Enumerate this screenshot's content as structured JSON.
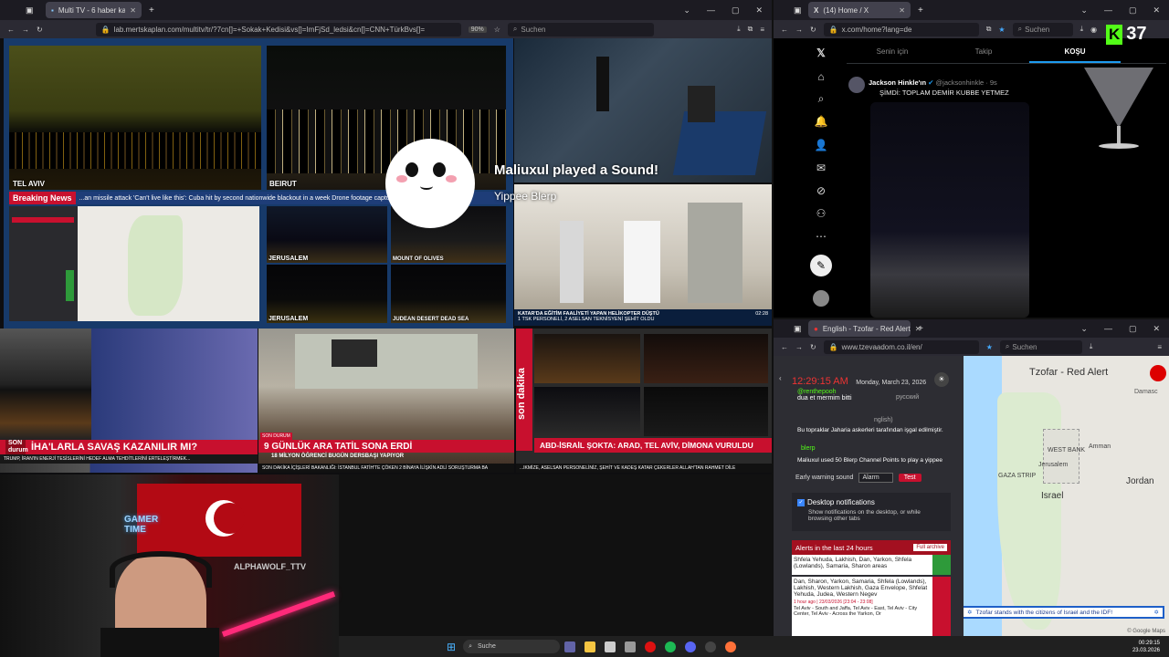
{
  "left_browser": {
    "tab_title": "Multi TV - 6 haber kanalını aynı",
    "url": "lab.mertskaplan.com/multitv/tr/?7cn[]=+Sokak+Kedisi&vs[]=ImFjSd_ledsi&cn[]=CNN+TürkBvs[]=",
    "zoom": "90%",
    "search_placeholder": "Suchen",
    "grid": {
      "tel_aviv": "TEL AVIV",
      "beirut": "BEIRUT",
      "breaking_news": "Breaking News",
      "breaking_ticker": "...an missile attack    'Can't live like this': Cuba hit by second nationwide blackout in a week    Drone footage capture    Evide",
      "jerusalem_1": "JERUSALEM",
      "mount_of_olives": "MOUNT OF OLIVES",
      "jerusalem_2": "JERUSALEM",
      "judean_desert": "JUDEAN DESERT DEAD SEA",
      "katar_caption": "KATAR'DA EĞİTİM FAALİYETİ YAPAN HELİKOPTER DÜŞTÜ",
      "katar_sub": "1 TSK PERSONELİ, 2 ASELSAN TEKNİSYENİ ŞEHİT OLDU",
      "katar_time": "02:28",
      "ht_headline": "İHA'LARLA SAVAŞ KAZANILIR MI?",
      "ht_son_durum": "SON durum",
      "ht_ticker": "TRUMP, İRAN'IN ENERJİ TESİSLERİNİ HEDEF ALMA TEHDİTLERİNİ ERTELEŞTİRMEK...",
      "hg_headline": "9 GÜNLÜK ARA TATİL SONA ERDİ",
      "hg_sub": "18 MİLYON ÖĞRENCİ BUGÜN DERSBAŞI YAPIYOR",
      "hg_son_durum": "SON DURUM",
      "hg_ticker": "SON DAKİKA  İÇİŞLERİ BAKANLIĞI: İSTANBUL FATİH'TE ÇÖKEN 2 BİNAYA İLİŞKİN ADLİ SORUŞTURMA BA",
      "a_headline": "ABD-İSRAİL ŞOKTA: ARAD, TEL AVİV, DİMONA VURULDU",
      "a_son_dakika": "son dakika",
      "a_ticker": "...IKMİZE, ASELSAN PERSONELİNİZ, ŞEHİT VE KADEŞ KATAR ÇEKERLER ALLAH'TAN RAHMET DİLE"
    },
    "alert": {
      "title": "Maliuxul played a Sound!",
      "subtitle": "Yippee Blerp"
    }
  },
  "x_browser": {
    "tab_title": "(14) Home / X",
    "url": "x.com/home?lang=de",
    "search_placeholder": "Suchen",
    "tabs": [
      "Senin için",
      "Takip",
      "KOŞU"
    ],
    "badge_count": "37",
    "tweet": {
      "author": "Jackson Hinkle'ın",
      "handle": "@jacksonhinkle · 9s",
      "text": "ŞİMDİ: TOPLAM DEMİR KUBBE YETMEZ"
    }
  },
  "redalert_browser": {
    "tab_title": "English - Tzofar - Red Alert",
    "url": "www.tzevaadom.co.il/en/",
    "search_placeholder": "Suchen",
    "time": "12:29:15 AM",
    "date": "Monday, March 23, 2026",
    "chat": [
      {
        "user": "@renthepooh",
        "msg": "dua et mermim bitti"
      },
      {
        "user": "",
        "msg": "Bu topraklar Jaharia askerleri tarafından işgal edilmiştir."
      },
      {
        "user": "blerp",
        "msg": "Maliuxul used 50 Blerp Channel Points to play a yippee"
      }
    ],
    "lang_russian": "русский",
    "lang_english": "nglish)",
    "early_warning_label": "Early warning sound",
    "early_warning_value": "Alarm",
    "test_button": "Test",
    "desktop_notifications": "Desktop notifications",
    "desktop_notifications_desc": "Show notifications on the desktop, or while browsing other tabs",
    "alerts_title": "Alerts in the last 24 hours",
    "full_archive": "Full archive",
    "alert_1": "Shfela Yehuda, Lakhish, Dan, Yarkon, Shfela (Lowlands), Samaria, Sharon areas",
    "alert_2": "Dan, Sharon, Yarkon, Samaria, Shfela (Lowlands), Lakhish, Western Lakhish, Gaza Envelope, Shfelat Yehuda, Judea, Western Negev",
    "alert_time": "1 hour ago | 23/03/2026 [23:04 - 23:08]",
    "alert_3": "Tel Aviv - South and Jaffa, Tel Aviv - East, Tel Aviv - City Center, Tel Aviv - Across the Yarkon, Or",
    "map_title": "Tzofar - Red Alert",
    "map_labels": {
      "west_bank": "WEST BANK",
      "gaza": "GAZA STRIP",
      "israel": "Israel",
      "jordan": "Jordan",
      "amman": "Amman",
      "jerusalem": "Jerusalem",
      "damascus": "Damasc"
    },
    "banner": "Tzofar stands with the citizens of Israel and the IDF!",
    "map_attribution": "© Google Maps"
  },
  "webcam": {
    "gamer_sign": "GAMER TIME",
    "wolf_sign": "ALPHAWOLF_TTV"
  },
  "taskbar": {
    "search": "Suche",
    "clock_time": "00:29:15",
    "clock_date": "23.03.2026"
  }
}
